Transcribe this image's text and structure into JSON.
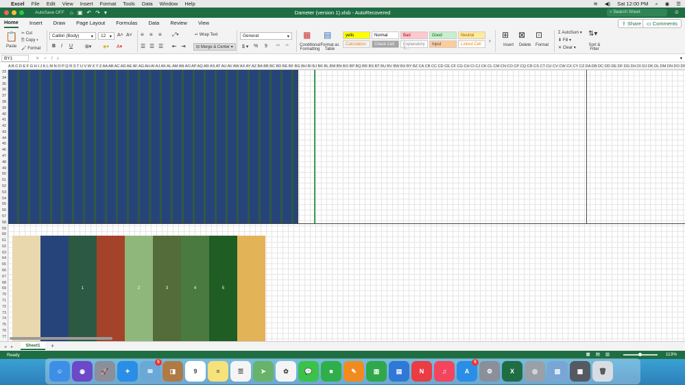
{
  "menubar": {
    "app_name": "Excel",
    "items": [
      "File",
      "Edit",
      "View",
      "Insert",
      "Format",
      "Tools",
      "Data",
      "Window",
      "Help"
    ],
    "clock": "Sat 12:00 PM"
  },
  "titlebar": {
    "autosave_label": "AutoSave",
    "autosave_state": "OFF",
    "document_title": "Dameter (version 1).xlsb - AutoRecovered",
    "search_placeholder": "Search Sheet"
  },
  "ribbon_tabs": {
    "tabs": [
      "Home",
      "Insert",
      "Draw",
      "Page Layout",
      "Formulas",
      "Data",
      "Review",
      "View"
    ],
    "active": "Home",
    "share_label": "Share",
    "comments_label": "Comments"
  },
  "ribbon": {
    "paste_label": "Paste",
    "cut_label": "Cut",
    "copy_label": "Copy",
    "format_label": "Format",
    "font_name": "Calibri (Body)",
    "font_size": "12",
    "bold": "B",
    "italic": "I",
    "underline": "U",
    "wrap_text_label": "Wrap Text",
    "merge_center_label": "Merge & Center",
    "number_format": "General",
    "currency_symbol": "$",
    "percent_symbol": "%",
    "comma_symbol": "9",
    "conditional_formatting_label": "Conditional Formatting",
    "format_as_table_label": "Format as Table",
    "styles": [
      {
        "name": "yello",
        "bg": "#ffff00",
        "fg": "#000000"
      },
      {
        "name": "Normal",
        "bg": "#ffffff",
        "fg": "#000000"
      },
      {
        "name": "Bad",
        "bg": "#ffc7ce",
        "fg": "#9c0006"
      },
      {
        "name": "Good",
        "bg": "#c6efce",
        "fg": "#006100"
      },
      {
        "name": "Neutral",
        "bg": "#ffeb9c",
        "fg": "#9c5700"
      },
      {
        "name": "Calculation",
        "bg": "#f2f2f2",
        "fg": "#fa7d00"
      },
      {
        "name": "Check Cell",
        "bg": "#a5a5a5",
        "fg": "#ffffff"
      },
      {
        "name": "Explanatory T...",
        "bg": "#ffffff",
        "fg": "#7f7f7f"
      },
      {
        "name": "Input",
        "bg": "#ffcc99",
        "fg": "#3f3f76"
      },
      {
        "name": "Linked Cell",
        "bg": "#ffffff",
        "fg": "#fa7d00"
      }
    ],
    "insert_label": "Insert",
    "delete_label": "Delete",
    "format_cells_label": "Format",
    "autosum_label": "AutoSum",
    "fill_label": "Fill",
    "clear_label": "Clear",
    "sort_filter_label": "Sort & Filter"
  },
  "formula_bar": {
    "name_box": "BY1",
    "fx": "fx",
    "content": ""
  },
  "grid": {
    "column_header_text": "A B C D E F G H I J K L M N O P Q R S T U V W X Y Z AA AB AC AD AE AF AG AH AI AJ AK AL AM AN AO AP AQ AR AS AT AU AV AW AX AY AZ BA BB BC BD BE BF BG BH BI BJ BK BL BM BN BO BP BQ BR BS BT BU BV BW BX BY BZ CA CB CC CD CE CF CG CH CI CJ CK CL CM CN CO CP CQ CR CS CT CU CV CW CX CY CZ DA DB DC DD DE DF DG DH DI DJ DK DL DM DN DO DP DQ DR DS DT DU DV DW DX DY DZ EA EB EC ED EE EF EG EH EI EJ EK EL EM EN EO EP EQ ER ES ET EU EV EW EX EY EZ FA FB FC FD FE FF FG FH FI FJ FK",
    "row_numbers": [
      "33",
      "34",
      "35",
      "36",
      "37",
      "38",
      "39",
      "40",
      "41",
      "42",
      "43",
      "44",
      "45",
      "46",
      "47",
      "48",
      "49",
      "50",
      "51",
      "52",
      "53",
      "54",
      "55",
      "56",
      "57",
      "58",
      "59",
      "60",
      "61",
      "62",
      "63",
      "64",
      "65",
      "66",
      "67",
      "68",
      "69",
      "70",
      "71",
      "72",
      "73",
      "74",
      "75",
      "76",
      "77"
    ],
    "stripe_colors": [
      "#27447a",
      "#2e5a40"
    ],
    "swatches": [
      {
        "color": "#e9d8ae",
        "label": ""
      },
      {
        "color": "#27447a",
        "label": ""
      },
      {
        "color": "#2b5941",
        "label": "1"
      },
      {
        "color": "#a5432a",
        "label": ""
      },
      {
        "color": "#8fb77b",
        "label": "2"
      },
      {
        "color": "#536c3a",
        "label": "3"
      },
      {
        "color": "#4b7a40",
        "label": "4"
      },
      {
        "color": "#1f5d25",
        "label": "5"
      },
      {
        "color": "#e3b358",
        "label": ""
      }
    ]
  },
  "sheet_tabs": {
    "tabs": [
      "Sheet1"
    ],
    "add_label": "+"
  },
  "status_bar": {
    "status": "Ready",
    "zoom": "113%"
  },
  "dock": {
    "apps": [
      {
        "name": "finder-icon",
        "color": "#3d8ee6",
        "glyph": "☺",
        "badge": ""
      },
      {
        "name": "siri-icon",
        "color": "#6b49c8",
        "glyph": "◉",
        "badge": ""
      },
      {
        "name": "launchpad-icon",
        "color": "#8a8f99",
        "glyph": "🚀",
        "badge": ""
      },
      {
        "name": "safari-icon",
        "color": "#2a8ee6",
        "glyph": "✦",
        "badge": ""
      },
      {
        "name": "mail-icon",
        "color": "#6aa8d8",
        "glyph": "✉",
        "badge": "5"
      },
      {
        "name": "contacts-icon",
        "color": "#b07a45",
        "glyph": "◨",
        "badge": ""
      },
      {
        "name": "calendar-icon",
        "color": "#ffffff",
        "glyph": "9",
        "badge": ""
      },
      {
        "name": "notes-icon",
        "color": "#f5e27a",
        "glyph": "≡",
        "badge": ""
      },
      {
        "name": "reminders-icon",
        "color": "#f4f4f4",
        "glyph": "☰",
        "badge": ""
      },
      {
        "name": "maps-icon",
        "color": "#67b36a",
        "glyph": "➤",
        "badge": ""
      },
      {
        "name": "photos-icon",
        "color": "#f4f4f4",
        "glyph": "✿",
        "badge": ""
      },
      {
        "name": "messages-icon",
        "color": "#3ac24a",
        "glyph": "💬",
        "badge": ""
      },
      {
        "name": "facetime-icon",
        "color": "#2faf4a",
        "glyph": "■",
        "badge": ""
      },
      {
        "name": "pages-icon",
        "color": "#f28b1f",
        "glyph": "✎",
        "badge": ""
      },
      {
        "name": "numbers-icon",
        "color": "#2ea84a",
        "glyph": "▥",
        "badge": ""
      },
      {
        "name": "keynote-icon",
        "color": "#2f78d6",
        "glyph": "▤",
        "badge": ""
      },
      {
        "name": "news-icon",
        "color": "#ea3c45",
        "glyph": "N",
        "badge": ""
      },
      {
        "name": "music-icon",
        "color": "#f4455e",
        "glyph": "♫",
        "badge": ""
      },
      {
        "name": "app-store-icon",
        "color": "#2a8ee6",
        "glyph": "A",
        "badge": "5"
      },
      {
        "name": "system-preferences-icon",
        "color": "#8a8f99",
        "glyph": "⚙",
        "badge": ""
      },
      {
        "name": "excel-icon",
        "color": "#1f6e43",
        "glyph": "X",
        "badge": ""
      },
      {
        "name": "disk-utility-icon",
        "color": "#9aa0a8",
        "glyph": "◎",
        "badge": ""
      },
      {
        "name": "preview-icon",
        "color": "#7aa6d6",
        "glyph": "▧",
        "badge": ""
      },
      {
        "name": "photo-folder-icon",
        "color": "#555a60",
        "glyph": "▦",
        "badge": ""
      },
      {
        "name": "trash-icon",
        "color": "#d8dde3",
        "glyph": "🗑",
        "badge": ""
      }
    ]
  }
}
